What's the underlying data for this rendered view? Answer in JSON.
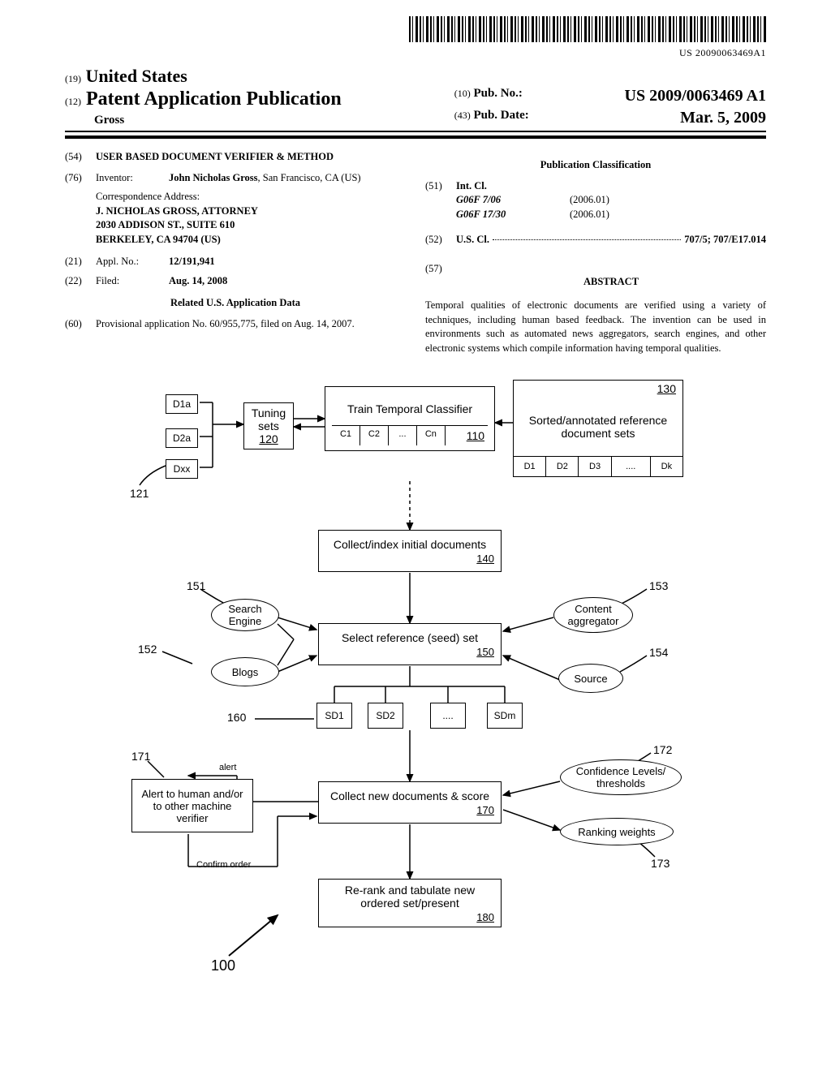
{
  "barcode_text": "US 20090063469A1",
  "header": {
    "country_code": "(19)",
    "country": "United States",
    "pub_code": "(12)",
    "pub_type": "Patent Application Publication",
    "author": "Gross",
    "pubno_code": "(10)",
    "pubno_label": "Pub. No.:",
    "pubno_value": "US 2009/0063469 A1",
    "pubdate_code": "(43)",
    "pubdate_label": "Pub. Date:",
    "pubdate_value": "Mar. 5, 2009"
  },
  "biblio": {
    "title_code": "(54)",
    "title": "USER BASED DOCUMENT VERIFIER & METHOD",
    "inventor_code": "(76)",
    "inventor_label": "Inventor:",
    "inventor_value": "John Nicholas Gross",
    "inventor_loc": ", San Francisco, CA (US)",
    "correspondence_label": "Correspondence Address:",
    "correspondence_name": "J. NICHOLAS GROSS, ATTORNEY",
    "correspondence_street": "2030 ADDISON ST., SUITE 610",
    "correspondence_city": "BERKELEY, CA 94704 (US)",
    "applno_code": "(21)",
    "applno_label": "Appl. No.:",
    "applno_value": "12/191,941",
    "filed_code": "(22)",
    "filed_label": "Filed:",
    "filed_value": "Aug. 14, 2008",
    "related_head": "Related U.S. Application Data",
    "provisional_code": "(60)",
    "provisional_text": "Provisional application No. 60/955,775, filed on Aug. 14, 2007.",
    "classif_head": "Publication Classification",
    "intcl_code": "(51)",
    "intcl_label": "Int. Cl.",
    "intcl_rows": [
      {
        "cls": "G06F 7/06",
        "yr": "(2006.01)"
      },
      {
        "cls": "G06F 17/30",
        "yr": "(2006.01)"
      }
    ],
    "uscl_code": "(52)",
    "uscl_label": "U.S. Cl.",
    "uscl_value": "707/5; 707/E17.014",
    "abstract_code": "(57)",
    "abstract_head": "ABSTRACT",
    "abstract_text": "Temporal qualities of electronic documents are verified using a variety of techniques, including human based feedback. The invention can be used in environments such as automated news aggregators, search engines, and other electronic systems which compile information having temporal qualities."
  },
  "diagram": {
    "tuning": {
      "label": "Tuning sets",
      "ref": "120"
    },
    "train": {
      "label": "Train Temporal Classifier",
      "ref": "110"
    },
    "sorted": {
      "label": "Sorted/annotated reference document sets",
      "ref": "130"
    },
    "docs_small": [
      "D1a",
      "D2a",
      "Dxx"
    ],
    "c_cells": [
      "C1",
      "C2",
      "...",
      "Cn"
    ],
    "d_cells": [
      "D1",
      "D2",
      "D3",
      "....",
      "Dk"
    ],
    "collect_idx": {
      "label": "Collect/index initial documents",
      "ref": "140"
    },
    "select_seed": {
      "label": "Select reference (seed) set",
      "ref": "150"
    },
    "sd_cells": [
      "SD1",
      "SD2",
      "....",
      "SDm"
    ],
    "collect_score": {
      "label": "Collect new documents & score",
      "ref": "170"
    },
    "rerank": {
      "label": "Re-rank and tabulate new ordered set/present",
      "ref": "180"
    },
    "ovals": {
      "search": "Search Engine",
      "blogs": "Blogs",
      "content": "Content aggregator",
      "source": "Source",
      "conf": "Confidence Levels/ thresholds",
      "ranking": "Ranking weights"
    },
    "alert_box": "Alert to human and/or to other machine verifier",
    "labels": {
      "n121": "121",
      "n151": "151",
      "n152": "152",
      "n153": "153",
      "n154": "154",
      "n160": "160",
      "n171": "171",
      "n172": "172",
      "n173": "173",
      "n100": "100",
      "alert_txt": "alert",
      "confirm_txt": "Confirm order"
    }
  }
}
